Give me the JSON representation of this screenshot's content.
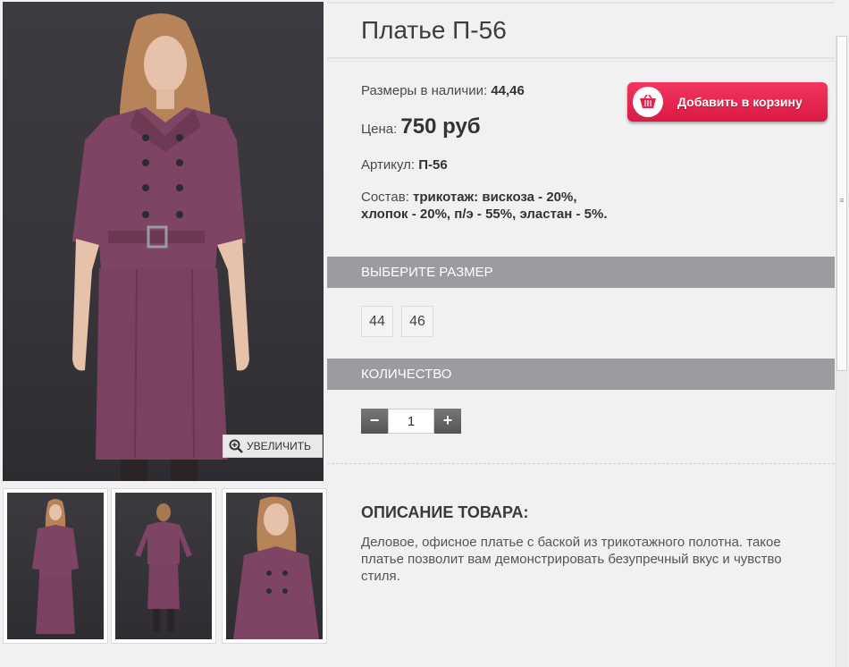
{
  "product": {
    "title": "Платье П-56",
    "sizes_label": "Размеры в наличии: ",
    "sizes_value": "44,46",
    "price_label": "Цена: ",
    "price_value": "750 руб",
    "sku_label": "Артикул: ",
    "sku_value": "П-56",
    "composition_label": "Состав: ",
    "composition_value": "трикотаж: вискоза - 20%, хлопок - 20%, п/э - 55%, эластан - 5%."
  },
  "gallery": {
    "zoom_label": "УВЕЛИЧИТЬ",
    "thumbnails": 3
  },
  "cart": {
    "add_label": "Добавить в корзину",
    "icon": "basket-icon",
    "color": "#e1244e"
  },
  "size_section": {
    "header": "ВЫБЕРИТЕ РАЗМЕР",
    "options": [
      "44",
      "46"
    ]
  },
  "quantity": {
    "header": "КОЛИЧЕСТВО",
    "minus": "−",
    "plus": "+",
    "value": "1"
  },
  "description": {
    "title": "ОПИСАНИЕ ТОВАРА:",
    "text": "Деловое, офисное платье с баской из трикотажного полотна. такое платье позволит вам демонстрировать безупречный вкус и чувство стиля."
  },
  "colors": {
    "dress": "#7d4463",
    "background": "#f1f1f1",
    "section_bar": "#9a9ca0"
  }
}
